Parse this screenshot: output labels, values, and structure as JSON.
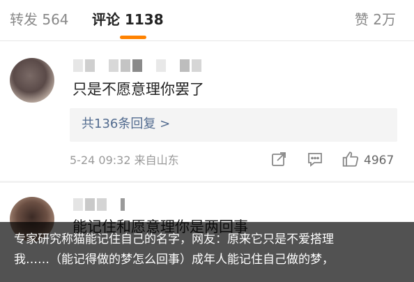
{
  "tabs": {
    "repost": "转发 564",
    "comment": "评论 1138",
    "like": "赞 2万"
  },
  "colors": {
    "accent": "#ff8200",
    "link": "#526b8f"
  },
  "comments": [
    {
      "text": "只是不愿意理你罢了",
      "replies_link": "共136条回复 >",
      "meta": "5-24 09:32  来自山东",
      "like_count": "4967",
      "icons": [
        "share-icon",
        "reply-icon",
        "like-icon"
      ]
    },
    {
      "text": "能记住和愿意理你是两回事"
    }
  ],
  "caption": {
    "line1": "专家研究称猫能记住自己的名字，网友：原来它只是不爱搭理",
    "line2": "我……（能记得做的梦怎么回事）成年人能记住自己做的梦，"
  }
}
